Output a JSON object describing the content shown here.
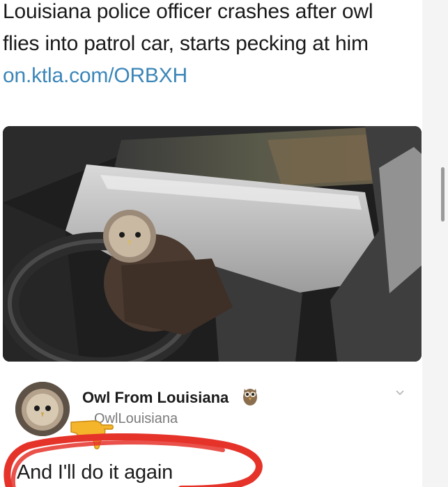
{
  "headline": {
    "text": "Louisiana police officer crashes after owl flies into patrol car, starts pecking at him",
    "link": "on.ktla.com/ORBXH"
  },
  "tweet": {
    "display_name": "Owl From Louisiana",
    "handle": "OwlLouisiana",
    "text": "And I'll do it again"
  },
  "icons": {
    "menu": "chevron-down-icon",
    "pointer": "pointing-hand-emoji",
    "name_emoji": "owl-emoji"
  },
  "colors": {
    "link": "#3c86b8",
    "scribble": "#e5332a",
    "hand": "#f4b52a"
  }
}
